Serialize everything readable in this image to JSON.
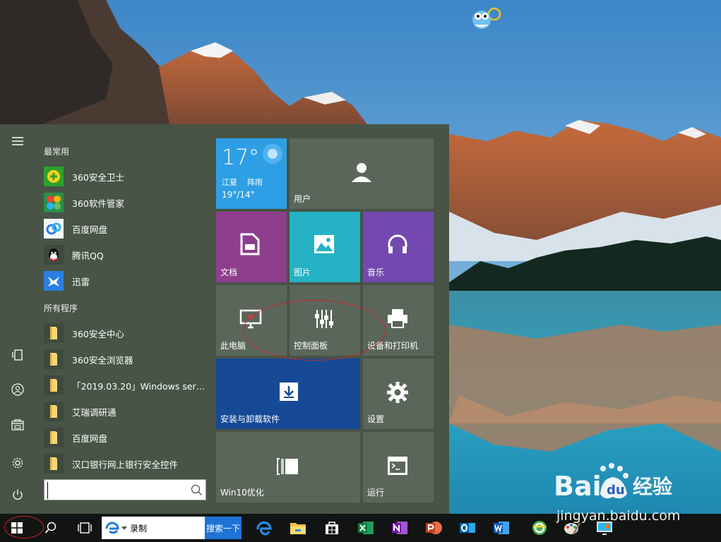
{
  "start_menu": {
    "frequent_title": "最常用",
    "all_programs_title": "所有程序",
    "frequent_apps": [
      {
        "label": "360安全卫士",
        "icon": "360-safe-icon"
      },
      {
        "label": "360软件管家",
        "icon": "360-software-manager-icon"
      },
      {
        "label": "百度网盘",
        "icon": "baidu-netdisk-icon"
      },
      {
        "label": "腾讯QQ",
        "icon": "qq-penguin-icon"
      },
      {
        "label": "迅雷",
        "icon": "thunder-icon"
      }
    ],
    "all_apps": [
      {
        "label": "360安全中心",
        "icon": "folder-icon"
      },
      {
        "label": "360安全浏览器",
        "icon": "folder-icon"
      },
      {
        "label": "「2019.03.20」Windows server...",
        "icon": "folder-icon"
      },
      {
        "label": "艾瑞调研通",
        "icon": "folder-icon"
      },
      {
        "label": "百度网盘",
        "icon": "folder-icon"
      },
      {
        "label": "汉口银行网上银行安全控件",
        "icon": "folder-icon"
      }
    ],
    "search_value": ""
  },
  "tiles": {
    "weather": {
      "temp": "17°",
      "location": "江夏",
      "condition": "阵雨",
      "range": "19°/14°",
      "color": "#2e9fe5"
    },
    "user": {
      "label": "用户"
    },
    "documents": {
      "label": "文档",
      "color": "#8e3e8c"
    },
    "pictures": {
      "label": "图片",
      "color": "#25b2c4"
    },
    "music": {
      "label": "音乐",
      "color": "#7448b0"
    },
    "this_pc": {
      "label": "此电脑"
    },
    "control_panel": {
      "label": "控制面板"
    },
    "devices_printers": {
      "label": "设备和打印机"
    },
    "uninstall": {
      "label": "安装与卸载软件",
      "color": "#174a96"
    },
    "settings": {
      "label": "设置"
    },
    "win10_optimize": {
      "label": "Win10优化"
    },
    "run": {
      "label": "运行"
    }
  },
  "taskbar": {
    "ie_text": "录制",
    "search_button": "搜索一下",
    "apps": [
      "edge-icon",
      "file-explorer-icon",
      "store-icon",
      "excel-icon",
      "onenote-icon",
      "powerpoint-icon",
      "outlook-icon",
      "word-icon",
      "360-browser-icon",
      "paint-icon",
      "remote-desktop-icon"
    ]
  },
  "watermark": {
    "brand_cn": "经验",
    "url": "jingyan.baidu.com"
  }
}
